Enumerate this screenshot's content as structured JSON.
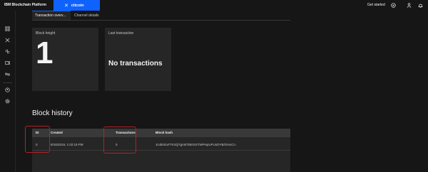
{
  "header": {
    "brand": "IBM Blockchain Platform",
    "network_label": "citcoin",
    "get_started": "Get started"
  },
  "tabs": [
    {
      "label": "Transaction overv..."
    },
    {
      "label": "Channel details"
    }
  ],
  "tiles": {
    "block_height_label": "Block height",
    "block_height_value": "1",
    "last_tx_label": "Last transaction",
    "last_tx_value": "No transactions"
  },
  "block_history": {
    "title": "Block history",
    "columns": [
      "ID",
      "Created",
      "Transactions",
      "Block hash"
    ],
    "rows": [
      {
        "id": "0",
        "created": "8/16/2019, 1:02:19 PM",
        "transactions": "0",
        "hash": "JUIb0GxFTK3QTgmkTBI0XSTWPHpUFUnDYB/GIsnC/="
      }
    ]
  },
  "colors": {
    "accent": "#0f62fe",
    "highlight": "#b3202a",
    "background": "#161616",
    "tile": "#262626"
  }
}
